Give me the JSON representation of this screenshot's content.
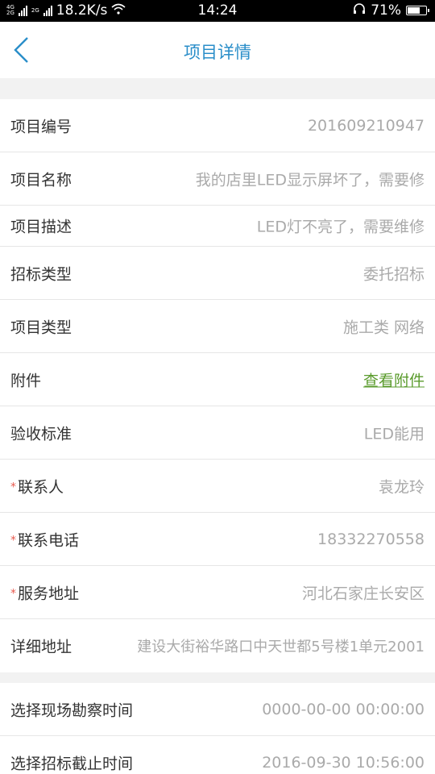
{
  "status_bar": {
    "net_top": "4G",
    "net_bottom": "2G",
    "net2": "2G",
    "speed": "18.2K/s",
    "time": "14:24",
    "battery": "71%",
    "battery_level": 0.71
  },
  "header": {
    "title": "项目详情",
    "back_icon": "chevron-left-icon"
  },
  "section1": [
    {
      "label": "项目编号",
      "value": "201609210947",
      "required": false
    },
    {
      "label": "项目名称",
      "value": "我的店里LED显示屏坏了，需要修",
      "required": false
    },
    {
      "label": "项目描述",
      "value": "LED灯不亮了，需要维修",
      "required": false
    },
    {
      "label": "招标类型",
      "value": "委托招标",
      "required": false
    },
    {
      "label": "项目类型",
      "value": "施工类 网络",
      "required": false
    },
    {
      "label": "附件",
      "value": "查看附件",
      "required": false,
      "link": true
    },
    {
      "label": "验收标准",
      "value": "LED能用",
      "required": false
    },
    {
      "label": "联系人",
      "value": "袁龙玲",
      "required": true
    },
    {
      "label": "联系电话",
      "value": "18332270558",
      "required": true
    },
    {
      "label": "服务地址",
      "value": "河北石家庄长安区",
      "required": true
    },
    {
      "label": "详细地址",
      "value": "建设大街裕华路口中天世都5号楼1单元2001",
      "required": false
    }
  ],
  "section2": [
    {
      "label": "选择现场勘察时间",
      "value": "0000-00-00 00:00:00"
    },
    {
      "label": "选择招标截止时间",
      "value": "2016-09-30 10:56:00"
    }
  ],
  "required_mark": "*",
  "colors": {
    "accent": "#2a8ec9",
    "link": "#5a9b2c",
    "required": "#e85a4f"
  }
}
